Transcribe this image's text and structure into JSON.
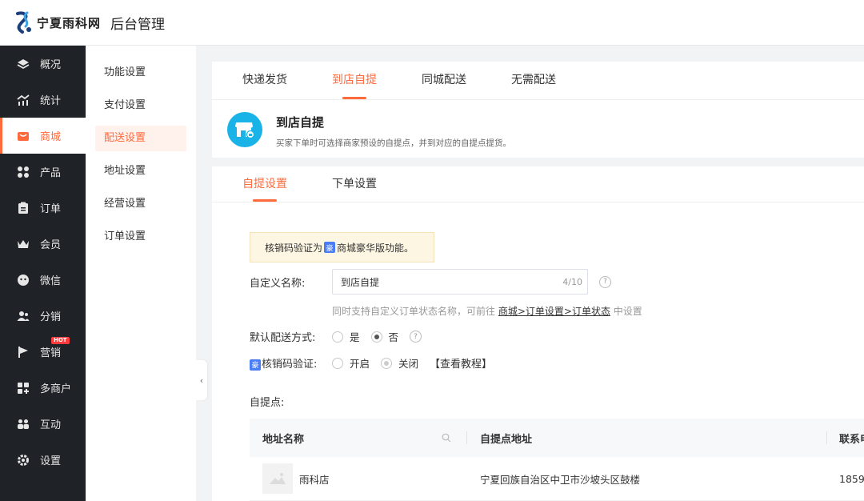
{
  "header": {
    "brand_name": "宁夏雨科网",
    "app_title": "后台管理"
  },
  "sidebar": {
    "items": [
      {
        "label": "概况",
        "icon": "diamond-icon"
      },
      {
        "label": "统计",
        "icon": "chart-icon"
      },
      {
        "label": "商城",
        "icon": "mall-icon"
      },
      {
        "label": "产品",
        "icon": "grid-icon"
      },
      {
        "label": "订单",
        "icon": "clipboard-icon"
      },
      {
        "label": "会员",
        "icon": "crown-icon"
      },
      {
        "label": "微信",
        "icon": "wechat-icon"
      },
      {
        "label": "分销",
        "icon": "users-icon"
      },
      {
        "label": "营销",
        "icon": "flag-icon",
        "badge": "HOT"
      },
      {
        "label": "多商户",
        "icon": "shop-icon"
      },
      {
        "label": "互动",
        "icon": "interact-icon"
      },
      {
        "label": "设置",
        "icon": "gear-icon"
      }
    ],
    "active_index": 2
  },
  "subnav": {
    "items": [
      "功能设置",
      "支付设置",
      "配送设置",
      "地址设置",
      "经营设置",
      "订单设置"
    ],
    "active_index": 2
  },
  "delivery_tabs": {
    "items": [
      "快递发货",
      "到店自提",
      "同城配送",
      "无需配送"
    ],
    "active_index": 1
  },
  "banner": {
    "title": "到店自提",
    "description": "买家下单时可选择商家预设的自提点，并到对应的自提点提货。"
  },
  "settings_tabs": {
    "items": [
      "自提设置",
      "下单设置"
    ],
    "active_index": 0
  },
  "notice": {
    "prefix": "核销码验证为",
    "badge": "豪",
    "suffix": "商城豪华版功能。"
  },
  "form": {
    "custom_name": {
      "label": "自定义名称:",
      "value": "到店自提",
      "counter": "4/10"
    },
    "hint": {
      "prefix": "同时支持自定义订单状态名称，可前往",
      "link": "商城>订单设置>订单状态",
      "suffix": "中设置"
    },
    "default_delivery": {
      "label": "默认配送方式:",
      "options": [
        "是",
        "否"
      ],
      "selected": "否"
    },
    "verify_code": {
      "badge": "豪",
      "label": "核销码验证:",
      "options": [
        "开启",
        "关闭"
      ],
      "selected": "关闭",
      "tutorial": "【查看教程】"
    }
  },
  "pickup": {
    "label": "自提点:",
    "columns": [
      "地址名称",
      "自提点地址",
      "联系电"
    ],
    "rows": [
      {
        "name": "雨科店",
        "address": "宁夏回族自治区中卫市沙坡头区鼓楼",
        "phone": "1859"
      }
    ]
  },
  "colors": {
    "accent": "#ff6a3d",
    "sidebar_bg": "#1f2226",
    "banner_icon": "#1ab3e8"
  }
}
